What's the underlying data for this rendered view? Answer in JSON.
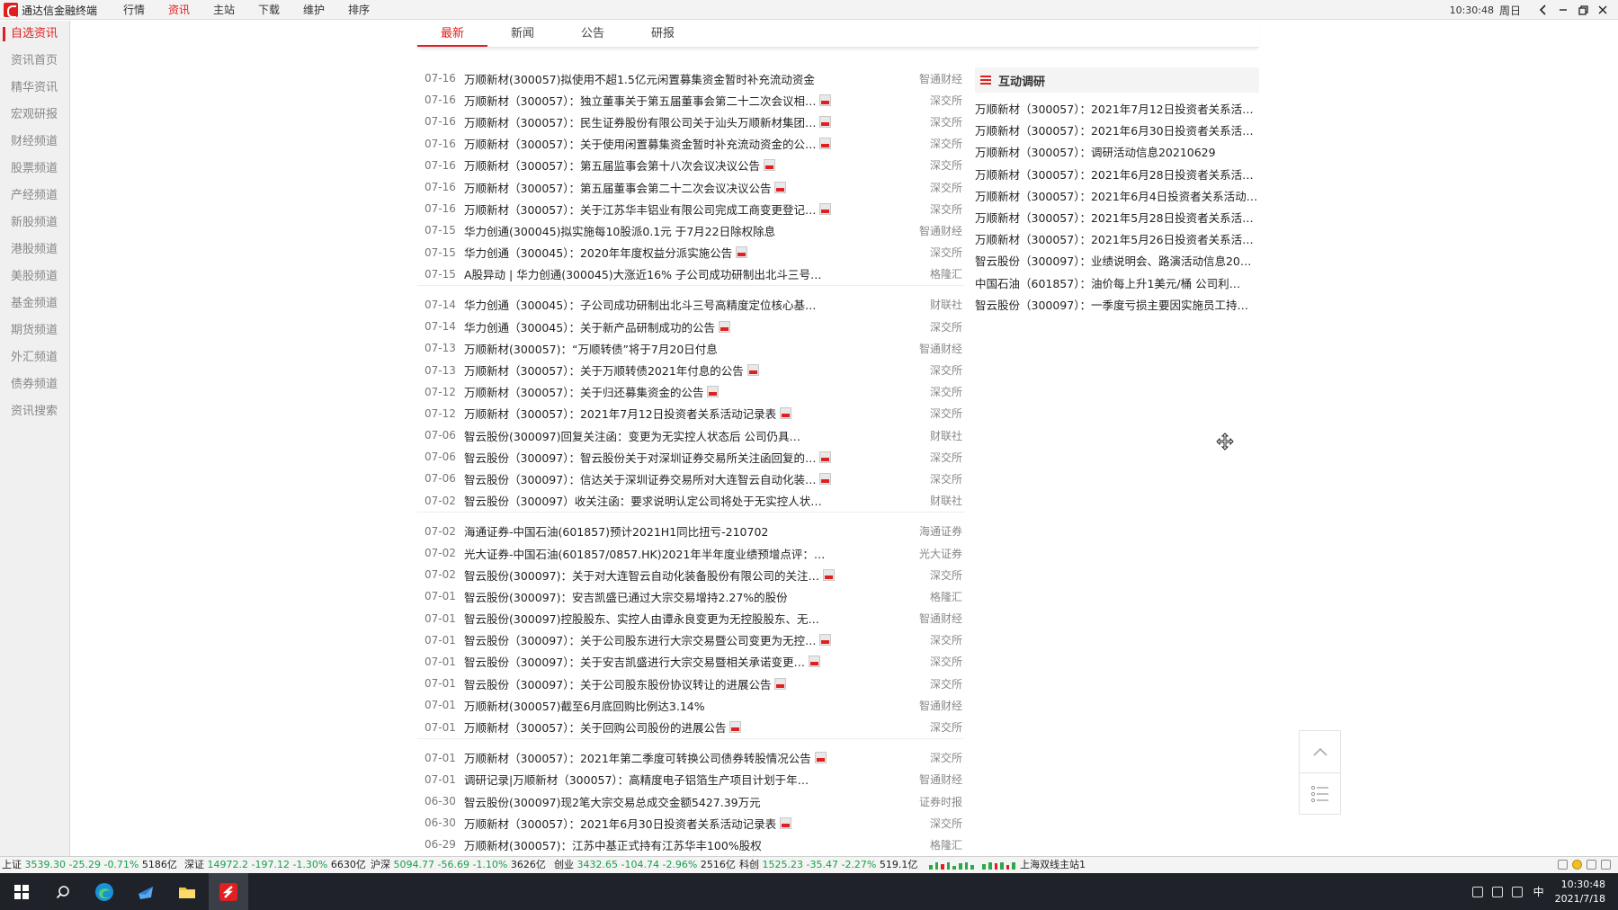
{
  "app": {
    "title": "通达信金融终端"
  },
  "menu": [
    "行情",
    "资讯",
    "主站",
    "下载",
    "维护",
    "排序"
  ],
  "window": {
    "time": "10:30:48",
    "weekday": "周日"
  },
  "sidebar": [
    "自选资讯",
    "资讯首页",
    "精华资讯",
    "宏观研报",
    "财经频道",
    "股票频道",
    "产经频道",
    "新股频道",
    "港股频道",
    "美股频道",
    "基金频道",
    "期货频道",
    "外汇频道",
    "债券频道",
    "资讯搜索"
  ],
  "tabs": [
    "最新",
    "新闻",
    "公告",
    "研报"
  ],
  "news_groups": [
    [
      {
        "date": "07-16",
        "title": "万顺新材(300057)拟使用不超1.5亿元闲置募集资金暂时补充流动资金",
        "pdf": false,
        "source": "智通财经"
      },
      {
        "date": "07-16",
        "title": "万顺新材（300057）：独立董事关于第五届董事会第二十二次会议相…",
        "pdf": true,
        "source": "深交所"
      },
      {
        "date": "07-16",
        "title": "万顺新材（300057）：民生证券股份有限公司关于汕头万顺新材集团…",
        "pdf": true,
        "source": "深交所"
      },
      {
        "date": "07-16",
        "title": "万顺新材（300057）：关于使用闲置募集资金暂时补充流动资金的公…",
        "pdf": true,
        "source": "深交所"
      },
      {
        "date": "07-16",
        "title": "万顺新材（300057）：第五届监事会第十八次会议决议公告",
        "pdf": true,
        "source": "深交所"
      },
      {
        "date": "07-16",
        "title": "万顺新材（300057）：第五届董事会第二十二次会议决议公告",
        "pdf": true,
        "source": "深交所"
      },
      {
        "date": "07-16",
        "title": "万顺新材（300057）：关于江苏华丰铝业有限公司完成工商变更登记…",
        "pdf": true,
        "source": "深交所"
      },
      {
        "date": "07-15",
        "title": "华力创通(300045)拟实施每10股派0.1元 于7月22日除权除息",
        "pdf": false,
        "source": "智通财经"
      },
      {
        "date": "07-15",
        "title": "华力创通（300045）：2020年年度权益分派实施公告",
        "pdf": true,
        "source": "深交所"
      },
      {
        "date": "07-15",
        "title": "A股异动 | 华力创通(300045)大涨近16% 子公司成功研制出北斗三号…",
        "pdf": false,
        "source": "格隆汇"
      }
    ],
    [
      {
        "date": "07-14",
        "title": "华力创通（300045）：子公司成功研制出北斗三号高精度定位核心基…",
        "pdf": false,
        "source": "财联社"
      },
      {
        "date": "07-14",
        "title": "华力创通（300045）：关于新产品研制成功的公告",
        "pdf": true,
        "source": "深交所"
      },
      {
        "date": "07-13",
        "title": "万顺新材(300057)：“万顺转债”将于7月20日付息",
        "pdf": false,
        "source": "智通财经"
      },
      {
        "date": "07-13",
        "title": "万顺新材（300057）：关于万顺转债2021年付息的公告",
        "pdf": true,
        "source": "深交所"
      },
      {
        "date": "07-12",
        "title": "万顺新材（300057）：关于归还募集资金的公告",
        "pdf": true,
        "source": "深交所"
      },
      {
        "date": "07-12",
        "title": "万顺新材（300057）：2021年7月12日投资者关系活动记录表",
        "pdf": true,
        "source": "深交所"
      },
      {
        "date": "07-06",
        "title": "智云股份(300097)回复关注函：变更为无实控人状态后 公司仍具…",
        "pdf": false,
        "source": "财联社"
      },
      {
        "date": "07-06",
        "title": "智云股份（300097）：智云股份关于对深圳证券交易所关注函回复的…",
        "pdf": true,
        "source": "深交所"
      },
      {
        "date": "07-06",
        "title": "智云股份（300097）：信达关于深圳证券交易所对大连智云自动化装…",
        "pdf": true,
        "source": "深交所"
      },
      {
        "date": "07-02",
        "title": "智云股份（300097）收关注函：要求说明认定公司将处于无实控人状…",
        "pdf": false,
        "source": "财联社"
      }
    ],
    [
      {
        "date": "07-02",
        "title": "海通证券-中国石油(601857)预计2021H1同比扭亏-210702",
        "pdf": false,
        "source": "海通证券"
      },
      {
        "date": "07-02",
        "title": "光大证券-中国石油(601857/0857.HK)2021年半年度业绩预增点评：…",
        "pdf": false,
        "source": "光大证券"
      },
      {
        "date": "07-02",
        "title": "智云股份(300097)：关于对大连智云自动化装备股份有限公司的关注…",
        "pdf": true,
        "source": "深交所"
      },
      {
        "date": "07-01",
        "title": "智云股份(300097)：安吉凯盛已通过大宗交易增持2.27%的股份",
        "pdf": false,
        "source": "格隆汇"
      },
      {
        "date": "07-01",
        "title": "智云股份(300097)控股股东、实控人由谭永良变更为无控股股东、无…",
        "pdf": false,
        "source": "智通财经"
      },
      {
        "date": "07-01",
        "title": "智云股份（300097）：关于公司股东进行大宗交易暨公司变更为无控…",
        "pdf": true,
        "source": "深交所"
      },
      {
        "date": "07-01",
        "title": "智云股份（300097）：关于安吉凯盛进行大宗交易暨相关承诺变更…",
        "pdf": true,
        "source": "深交所"
      },
      {
        "date": "07-01",
        "title": "智云股份（300097）：关于公司股东股份协议转让的进展公告",
        "pdf": true,
        "source": "深交所"
      },
      {
        "date": "07-01",
        "title": "万顺新材(300057)截至6月底回购比例达3.14%",
        "pdf": false,
        "source": "智通财经"
      },
      {
        "date": "07-01",
        "title": "万顺新材（300057）：关于回购公司股份的进展公告",
        "pdf": true,
        "source": "深交所"
      }
    ],
    [
      {
        "date": "07-01",
        "title": "万顺新材（300057）：2021年第二季度可转换公司债券转股情况公告",
        "pdf": true,
        "source": "深交所"
      },
      {
        "date": "07-01",
        "title": "调研记录|万顺新材（300057）：高精度电子铝箔生产项目计划于年…",
        "pdf": false,
        "source": "智通财经"
      },
      {
        "date": "06-30",
        "title": "智云股份(300097)现2笔大宗交易总成交金额5427.39万元",
        "pdf": false,
        "source": "证券时报"
      },
      {
        "date": "06-30",
        "title": "万顺新材（300057）：2021年6月30日投资者关系活动记录表",
        "pdf": true,
        "source": "深交所"
      },
      {
        "date": "06-29",
        "title": "万顺新材(300057)：江苏中基正式持有江苏华丰100%股权",
        "pdf": false,
        "source": "格隆汇"
      }
    ]
  ],
  "right_panel": {
    "title": "互动调研",
    "items": [
      "万顺新材（300057）：2021年7月12日投资者关系活…",
      "万顺新材（300057）：2021年6月30日投资者关系活…",
      "万顺新材（300057）：调研活动信息20210629",
      "万顺新材（300057）：2021年6月28日投资者关系活…",
      "万顺新材（300057）：2021年6月4日投资者关系活动…",
      "万顺新材（300057）：2021年5月28日投资者关系活…",
      "万顺新材（300057）：2021年5月26日投资者关系活…",
      "智云股份（300097）：业绩说明会、路演活动信息20…",
      "中国石油（601857）：油价每上升1美元/桶 公司利…",
      "智云股份（300097）：一季度亏损主要因实施员工持…"
    ]
  },
  "indices": [
    {
      "name": "上证",
      "price": "3539.30",
      "change": "-25.29",
      "pct": "-0.71%",
      "volume": "5186亿"
    },
    {
      "name": "深证",
      "price": "14972.2",
      "change": "-197.12",
      "pct": "-1.30%",
      "volume": "6630亿"
    },
    {
      "name": "沪深",
      "price": "5094.77",
      "change": "-56.69",
      "pct": "-1.10%",
      "volume": "3626亿"
    },
    {
      "name": "创业",
      "price": "3432.65",
      "change": "-104.74",
      "pct": "-2.96%",
      "volume": "2516亿"
    },
    {
      "name": "科创",
      "price": "1525.23",
      "change": "-35.47",
      "pct": "-2.27%",
      "volume": "519.1亿"
    }
  ],
  "ticker": "上海双线主站1",
  "taskbar": {
    "time": "10:30:48",
    "date": "2021/7/18",
    "lang": "中"
  },
  "colors": {
    "accent": "#e02020",
    "down": "#19a04a",
    "taskbar": "#1f2329"
  }
}
